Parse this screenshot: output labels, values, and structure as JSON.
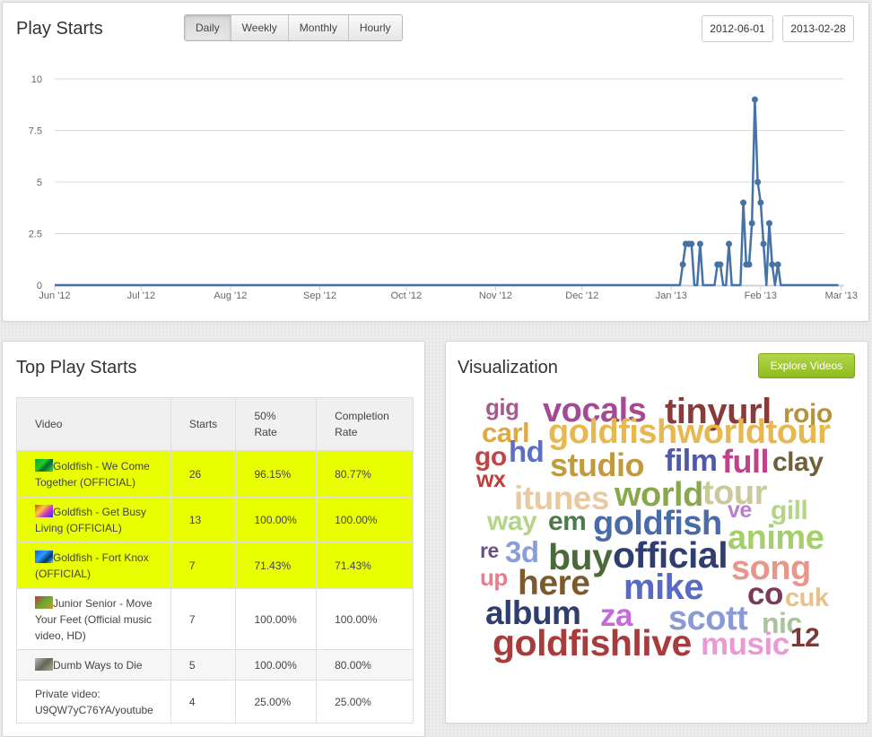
{
  "play_starts": {
    "title": "Play Starts",
    "ranges": [
      "Daily",
      "Weekly",
      "Monthly",
      "Hourly"
    ],
    "active_range": "Daily",
    "date_from": "2012-06-01",
    "date_separator": "-",
    "date_to": "2013-02-28",
    "line_color": "#4572a7"
  },
  "chart_data": {
    "type": "line",
    "title": "",
    "xlabel": "",
    "ylabel": "",
    "x_range": [
      "2012-06-01",
      "2013-02-28"
    ],
    "x_ticks": [
      "Jun '12",
      "Jul '12",
      "Aug '12",
      "Sep '12",
      "Oct '12",
      "Nov '12",
      "Dec '12",
      "Jan '13",
      "Feb '13",
      "Mar '13"
    ],
    "y_ticks": [
      "0",
      "2.5",
      "5",
      "7.5",
      "10"
    ],
    "ylim": [
      0,
      10
    ],
    "grid": true,
    "legend": "none",
    "series": [
      {
        "points": [
          [
            "2013-01-05",
            1
          ],
          [
            "2013-01-06",
            2
          ],
          [
            "2013-01-07",
            2
          ],
          [
            "2013-01-08",
            2
          ],
          [
            "2013-01-11",
            2
          ],
          [
            "2013-01-17",
            1
          ],
          [
            "2013-01-18",
            1
          ],
          [
            "2013-01-21",
            2
          ],
          [
            "2013-01-26",
            4
          ],
          [
            "2013-01-27",
            1
          ],
          [
            "2013-01-28",
            1
          ],
          [
            "2013-01-29",
            3
          ],
          [
            "2013-01-30",
            9
          ],
          [
            "2013-01-31",
            5
          ],
          [
            "2013-02-01",
            4
          ],
          [
            "2013-02-02",
            2
          ],
          [
            "2013-02-04",
            3
          ],
          [
            "2013-02-05",
            1
          ],
          [
            "2013-02-07",
            1
          ]
        ]
      }
    ]
  },
  "top_play_starts": {
    "title": "Top Play Starts",
    "columns": [
      "Video",
      "Starts",
      "50% Rate",
      "Completion Rate"
    ],
    "rows": [
      {
        "video": "Goldfish - We Come Together (OFFICIAL)",
        "starts": "26",
        "rate50": "96.15%",
        "completion": "80.77%",
        "highlight": true,
        "thumb": "goldfish1"
      },
      {
        "video": "Goldfish - Get Busy Living (OFFICIAL)",
        "starts": "13",
        "rate50": "100.00%",
        "completion": "100.00%",
        "highlight": true,
        "thumb": "goldfish2"
      },
      {
        "video": "Goldfish - Fort Knox (OFFICIAL)",
        "starts": "7",
        "rate50": "71.43%",
        "completion": "71.43%",
        "highlight": true,
        "thumb": "goldfish3"
      },
      {
        "video": "Junior Senior - Move Your Feet (Official music video, HD)",
        "starts": "7",
        "rate50": "100.00%",
        "completion": "100.00%",
        "highlight": false,
        "thumb": "junior"
      },
      {
        "video": "Dumb Ways to Die",
        "starts": "5",
        "rate50": "100.00%",
        "completion": "80.00%",
        "highlight": false,
        "thumb": "dumb"
      },
      {
        "video": "Private video: U9QW7yC76YA/youtube",
        "starts": "4",
        "rate50": "25.00%",
        "completion": "25.00%",
        "highlight": false,
        "thumb": ""
      }
    ]
  },
  "visualization": {
    "title": "Visualization",
    "explore_button": "Explore Videos",
    "words": [
      {
        "text": "gig",
        "color": "#a85a8a"
      },
      {
        "text": "vocals",
        "color": "#a24b94"
      },
      {
        "text": "tinyurl",
        "color": "#8b3a3a"
      },
      {
        "text": "rojo",
        "color": "#b5943c"
      },
      {
        "text": "carl",
        "color": "#e0a83e"
      },
      {
        "text": "goldfishworldtour",
        "color": "#e7b84f"
      },
      {
        "text": "go",
        "color": "#c24545"
      },
      {
        "text": "hd",
        "color": "#5b6fc4"
      },
      {
        "text": "studio",
        "color": "#c19a3e"
      },
      {
        "text": "film",
        "color": "#5058a8"
      },
      {
        "text": "full",
        "color": "#c2428a"
      },
      {
        "text": "clay",
        "color": "#6e5f3a"
      },
      {
        "text": "wx",
        "color": "#c23c3c"
      },
      {
        "text": "itunes",
        "color": "#e8c9a0"
      },
      {
        "text": "world",
        "color": "#89a84b"
      },
      {
        "text": "tour",
        "color": "#c9c99a"
      },
      {
        "text": "ve",
        "color": "#b87fcc"
      },
      {
        "text": "gill",
        "color": "#b5d48a"
      },
      {
        "text": "way",
        "color": "#b5d48a"
      },
      {
        "text": "em",
        "color": "#4d7a4d"
      },
      {
        "text": "goldfish",
        "color": "#4b6aa8"
      },
      {
        "text": "anime",
        "color": "#a5cf6a"
      },
      {
        "text": "re",
        "color": "#6b4f8a"
      },
      {
        "text": "3d",
        "color": "#8a9cd9"
      },
      {
        "text": "buy",
        "color": "#4a6a3a"
      },
      {
        "text": "official",
        "color": "#2f3e6e"
      },
      {
        "text": "song",
        "color": "#e8958a"
      },
      {
        "text": "up",
        "color": "#e87e8a"
      },
      {
        "text": "here",
        "color": "#7a5a2e"
      },
      {
        "text": "mike",
        "color": "#5a6ac4"
      },
      {
        "text": "co",
        "color": "#7a3a5a"
      },
      {
        "text": "cuk",
        "color": "#e8c08a"
      },
      {
        "text": "album",
        "color": "#2f3e6e"
      },
      {
        "text": "za",
        "color": "#c46ad9"
      },
      {
        "text": "scott",
        "color": "#8a9ad4"
      },
      {
        "text": "nic",
        "color": "#a8c49a"
      },
      {
        "text": "goldfishlive",
        "color": "#a83c3c"
      },
      {
        "text": "music",
        "color": "#e89ad4"
      },
      {
        "text": "12",
        "color": "#7a3a3a"
      }
    ]
  }
}
